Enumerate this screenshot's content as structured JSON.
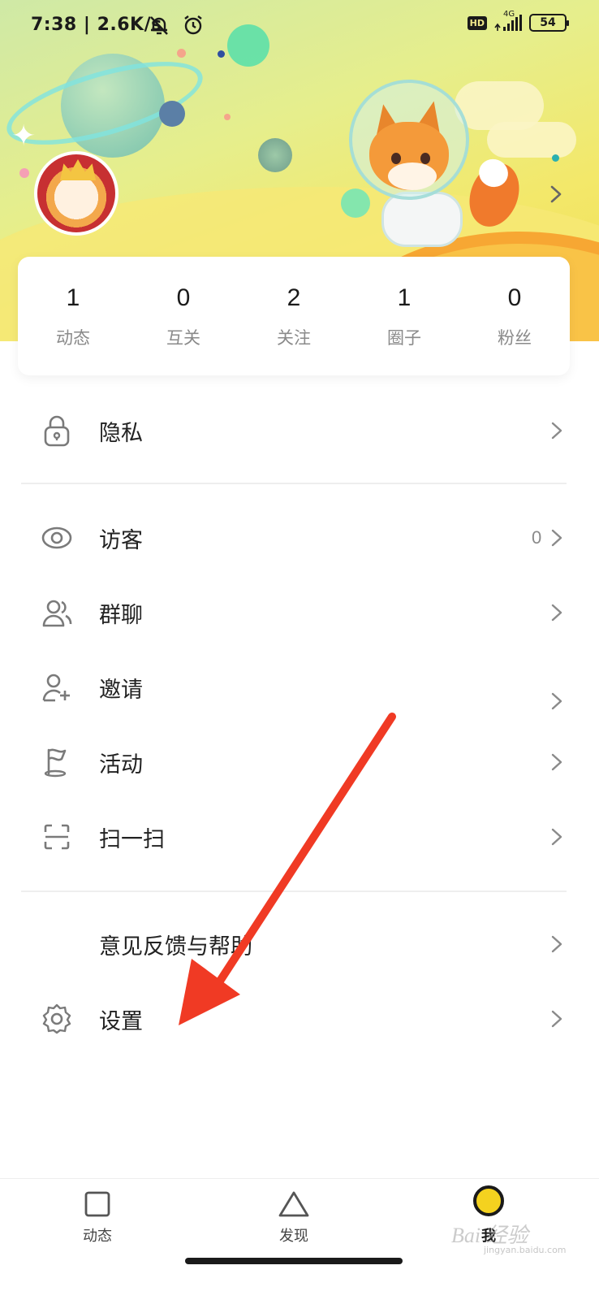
{
  "status_bar": {
    "time_speed": "7:38 | 2.6K/s",
    "network": "4G",
    "hd": "HD",
    "battery": "54"
  },
  "stats": [
    {
      "value": "1",
      "label": "动态"
    },
    {
      "value": "0",
      "label": "互关"
    },
    {
      "value": "2",
      "label": "关注"
    },
    {
      "value": "1",
      "label": "圈子"
    },
    {
      "value": "0",
      "label": "粉丝"
    }
  ],
  "menu": {
    "privacy": "隐私",
    "visitors": "访客",
    "visitors_count": "0",
    "group_chat": "群聊",
    "invite": "邀请",
    "activity": "活动",
    "scan": "扫一扫",
    "feedback": "意见反馈与帮助",
    "settings": "设置"
  },
  "bottom_nav": [
    {
      "label": "动态",
      "icon": "square-icon"
    },
    {
      "label": "发现",
      "icon": "triangle-icon"
    },
    {
      "label": "我",
      "icon": "profile-circle-icon",
      "active": true
    }
  ],
  "watermark": {
    "text": "Bai 经验",
    "sub": "jingyan.baidu.com"
  },
  "colors": {
    "accent_yellow": "#f4d21f",
    "annotation_red": "#f03a24"
  }
}
